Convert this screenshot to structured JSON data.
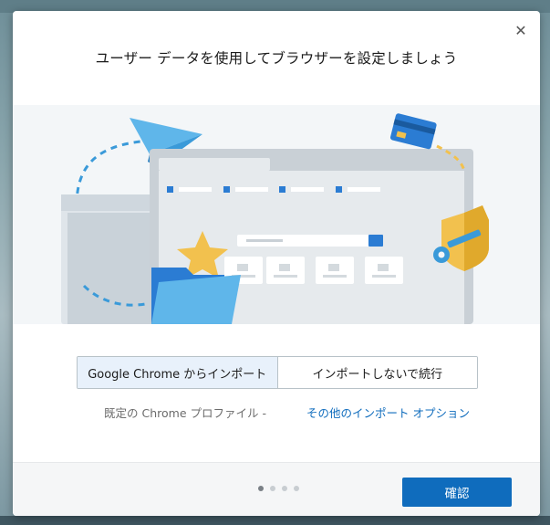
{
  "dialog": {
    "title": "ユーザー データを使用してブラウザーを設定しましょう",
    "close_glyph": "✕"
  },
  "import_options": {
    "from_chrome": "Google Chrome からインポート",
    "skip": "インポートしないで続行"
  },
  "profile": {
    "label": "既定の Chrome プロファイル -",
    "more_options": "その他のインポート オプション"
  },
  "footer": {
    "confirm_label": "確認",
    "page_count": 4,
    "current_page": 1
  },
  "colors": {
    "accent": "#0f6cbd",
    "illustration_bg": "#f3f6f8",
    "folder_blue": "#3a9ad9",
    "shield_gold": "#f2c14e",
    "window_gray": "#c9d0d6"
  }
}
